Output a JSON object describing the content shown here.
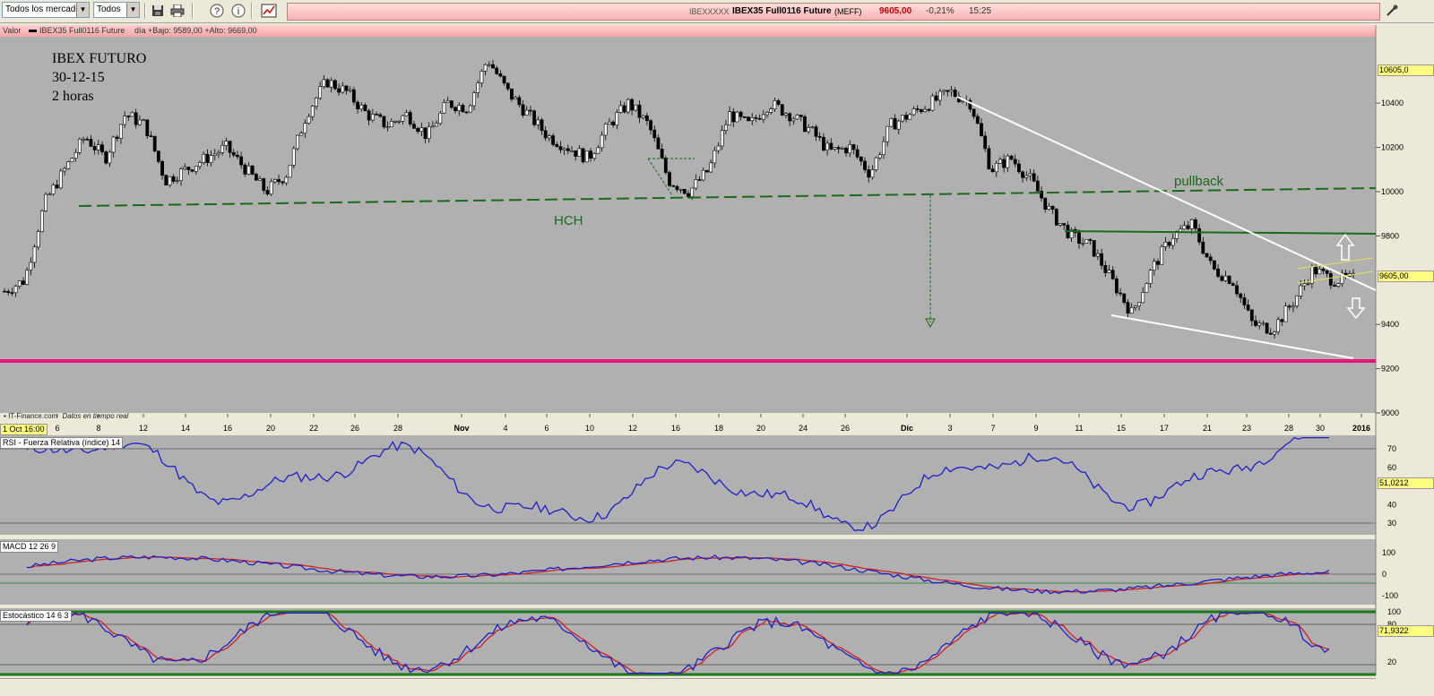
{
  "toolbar": {
    "market_select": "Todos los mercados",
    "filter_select": "Todos"
  },
  "quote_bar": {
    "code": "IBEXXXXX",
    "name": "IBEX35 Full0116 Future",
    "exchange": "(MEFF)",
    "price": "9605,00",
    "change": "-0,21%",
    "time": "15:25"
  },
  "chart_header": {
    "label": "Valor",
    "series": "IBEX35 Full0116 Future",
    "stats": "día +Bajo: 9589,00 +Alto: 9669,00"
  },
  "annotations": {
    "title_line1": "IBEX  FUTURO",
    "title_line2": "30-12-15",
    "title_line3": "2 horas",
    "hch": "HCH",
    "pullback": "pullback"
  },
  "watermark": {
    "brand": "IT-Finance.com",
    "realtime": "Datos en tiempo real"
  },
  "x_axis": {
    "start_label": "1 Oct 16:00",
    "ticks": [
      "6",
      "8",
      "12",
      "14",
      "16",
      "20",
      "22",
      "26",
      "28",
      "Nov",
      "4",
      "6",
      "10",
      "12",
      "16",
      "18",
      "20",
      "24",
      "26",
      "Dic",
      "3",
      "7",
      "9",
      "11",
      "15",
      "17",
      "21",
      "23",
      "28",
      "30",
      "2016"
    ]
  },
  "price_axis": {
    "ticks": [
      "10400",
      "10200",
      "10000",
      "9800",
      "9400",
      "9200",
      "9000"
    ],
    "high_tag": "10605,0",
    "current_tag": "9605,00"
  },
  "rsi": {
    "label": "RSI - Fuerza Relativa (índice) 14",
    "ticks": [
      "70",
      "60",
      "40",
      "30"
    ],
    "value_tag": "51,0212"
  },
  "macd": {
    "label": "MACD 12 26 9",
    "ticks": [
      "100",
      "0",
      "-100"
    ]
  },
  "stoch": {
    "label": "Estocástico 14 6 3",
    "ticks": [
      "100",
      "80",
      "20"
    ],
    "value_tag": "71,9322"
  },
  "colors": {
    "chart_bg": "#b0b0b0",
    "support_line": "#e8147a",
    "neckline": "#1a7a1a",
    "trendline": "#ffffff",
    "rsi_line": "#2020c8",
    "macd_line": "#2020c8",
    "signal_line": "#d02020"
  },
  "chart_data": {
    "type": "line",
    "title": "IBEX35 Full0116 Future",
    "series": [
      {
        "name": "IBEX35 Full0116 Future",
        "values": [
          9550,
          9600,
          9950,
          10100,
          10250,
          10150,
          10350,
          10300,
          10050,
          10100,
          10150,
          10200,
          10100,
          10000,
          10080,
          10350,
          10500,
          10450,
          10350,
          10300,
          10350,
          10250,
          10400,
          10380,
          10600,
          10450,
          10350,
          10250,
          10200,
          10150,
          10300,
          10400,
          10300,
          10050,
          10000,
          10100,
          10350,
          10300,
          10400,
          10350,
          10280,
          10180,
          10200,
          10080,
          10300,
          10350,
          10400,
          10450,
          10400,
          10100,
          10150,
          10050,
          9900,
          9800,
          9750,
          9600,
          9450,
          9650,
          9800,
          9850,
          9650,
          9600,
          9400,
          9380,
          9500,
          9650,
          9600,
          9605
        ]
      }
    ],
    "ylim": [
      9000,
      10700
    ]
  }
}
